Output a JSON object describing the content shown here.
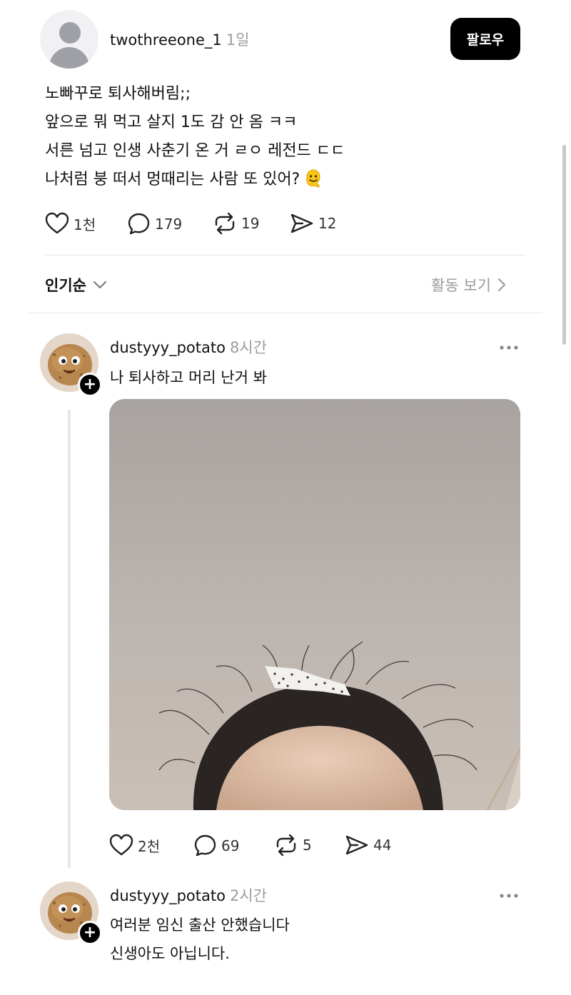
{
  "post": {
    "username": "twothreeone_1",
    "time": "1일",
    "follow_label": "팔로우",
    "lines": [
      "노빠꾸로 퇴사해버림;;",
      "앞으로 뭐 먹고 살지 1도 감 안 옴 ㅋㅋ",
      "서른 넘고 인생 사춘기 온 거 ㄹㅇ 레전드 ㄷㄷ",
      "나처럼 붕 떠서 멍때리는 사람 또 있어?"
    ],
    "actions": {
      "likes": "1천",
      "comments": "179",
      "reposts": "19",
      "shares": "12"
    }
  },
  "sort_bar": {
    "sort_label": "인기순",
    "activity_label": "활동 보기"
  },
  "comments": [
    {
      "username": "dustyyy_potato",
      "time": "8시간",
      "text": [
        "나 퇴사하고 머리 난거 봐"
      ],
      "actions": {
        "likes": "2천",
        "comments": "69",
        "reposts": "5",
        "shares": "44"
      }
    },
    {
      "username": "dustyyy_potato",
      "time": "2시간",
      "text": [
        "여러분 임신 출산 안했습니다",
        "신생아도 아닙니다."
      ]
    }
  ],
  "icons": {
    "like": "heart-icon",
    "comment": "comment-bubble-icon",
    "repost": "repost-icon",
    "share": "send-icon",
    "more": "more-icon",
    "sort": "chevron-down-icon",
    "activity": "chevron-right-icon"
  },
  "colors": {
    "follow_bg": "#000000",
    "muted_text": "#9c9c9c"
  }
}
